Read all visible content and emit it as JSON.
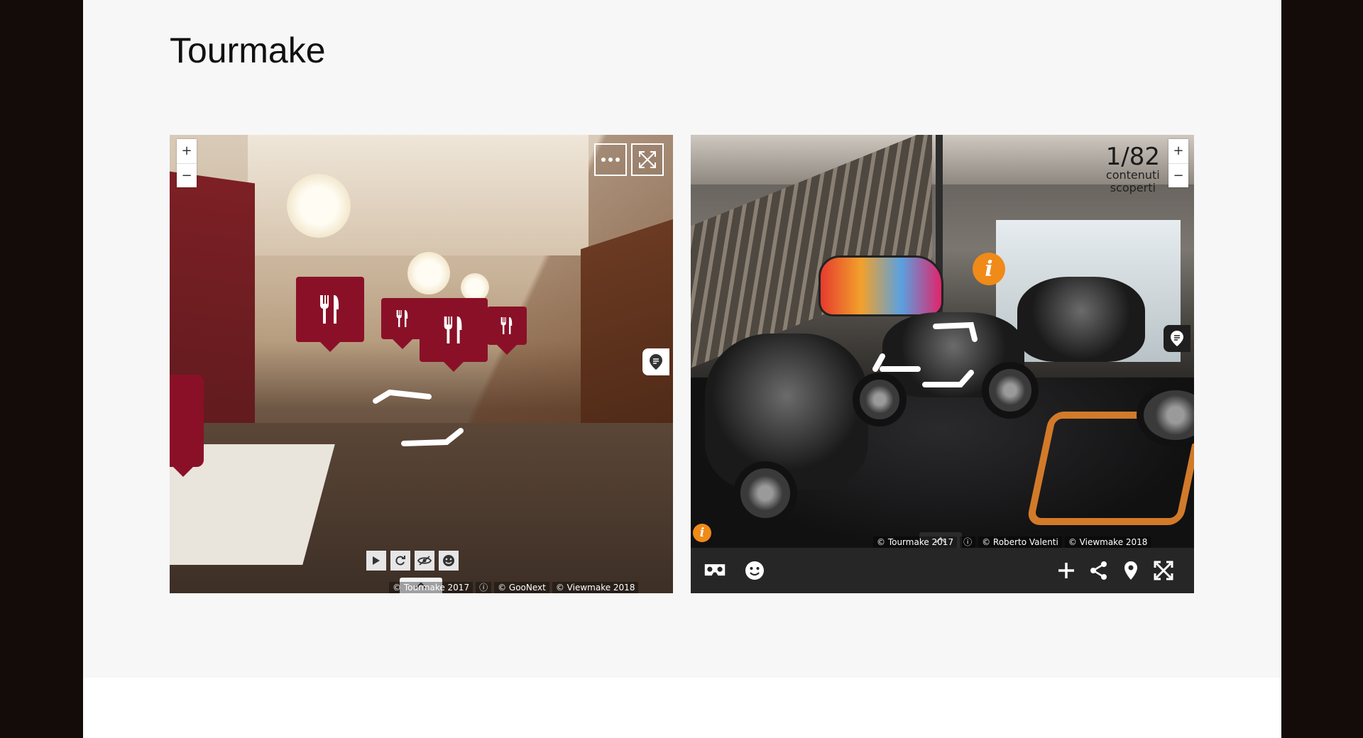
{
  "page": {
    "title": "Tourmake"
  },
  "viewer_restaurant": {
    "zoom_in": "+",
    "zoom_out": "−",
    "credits": [
      "© Tourmake 2017",
      "ⓘ",
      "© GooNext",
      "© Viewmake 2018"
    ],
    "icons": [
      "fork-knife-icon",
      "more-icon",
      "fullscreen-icon",
      "comment-icon",
      "play-icon",
      "rotate-icon",
      "hide-icon",
      "smiley-icon",
      "chevron-up-icon"
    ],
    "accent_color": "#8a1028"
  },
  "viewer_moto": {
    "zoom_in": "+",
    "zoom_out": "−",
    "counter_value": "1/82",
    "counter_label_1": "contenuti",
    "counter_label_2": "scoperti",
    "info_label": "i",
    "credits": [
      "© Tourmake 2017",
      "ⓘ",
      "© Roberto Valenti",
      "© Viewmake 2018"
    ],
    "icons": [
      "vr-headset-icon",
      "smiley-icon",
      "plus-icon",
      "share-icon",
      "map-pin-icon",
      "fullscreen-icon",
      "comment-icon",
      "info-icon",
      "chevron-up-icon"
    ],
    "accent_color": "#f08a18"
  }
}
